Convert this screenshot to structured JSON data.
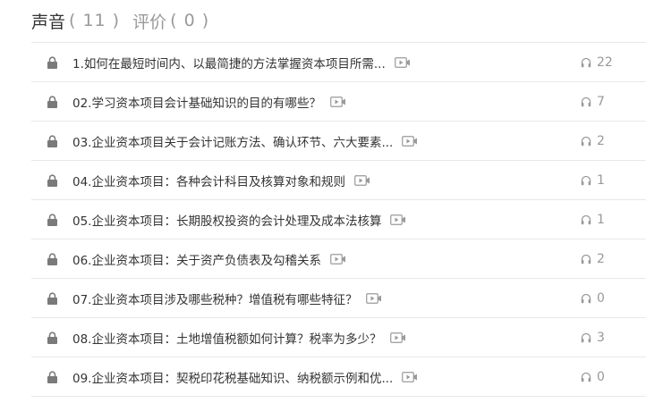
{
  "tabs": [
    {
      "label": "声音",
      "count": "( 11 )"
    },
    {
      "label": "评价",
      "count": "( 0 )"
    }
  ],
  "items": [
    {
      "title": "1.如何在最短时间内、以最简捷的方法掌握资本项目所需...",
      "plays": "22"
    },
    {
      "title": "02.学习资本项目会计基础知识的目的有哪些？",
      "plays": "7"
    },
    {
      "title": "03.企业资本项目关于会计记账方法、确认环节、六大要素...",
      "plays": "2"
    },
    {
      "title": "04.企业资本项目：各种会计科目及核算对象和规则",
      "plays": "1"
    },
    {
      "title": "05.企业资本项目：长期股权投资的会计处理及成本法核算",
      "plays": "1"
    },
    {
      "title": "06.企业资本项目：关于资产负债表及勾稽关系",
      "plays": "2"
    },
    {
      "title": "07.企业资本项目涉及哪些税种？增值税有哪些特征？",
      "plays": "0"
    },
    {
      "title": "08.企业资本项目：土地增值税额如何计算？税率为多少？",
      "plays": "3"
    },
    {
      "title": "09.企业资本项目：契税印花税基础知识、纳税额示例和优...",
      "plays": "0"
    }
  ],
  "icons": {
    "lock": "lock-icon",
    "video": "video-icon",
    "listens": "headphones-icon"
  },
  "colors": {
    "text": "#333333",
    "muted": "#999999",
    "icon": "#7a7a7a",
    "divider": "#e8e8e8"
  }
}
